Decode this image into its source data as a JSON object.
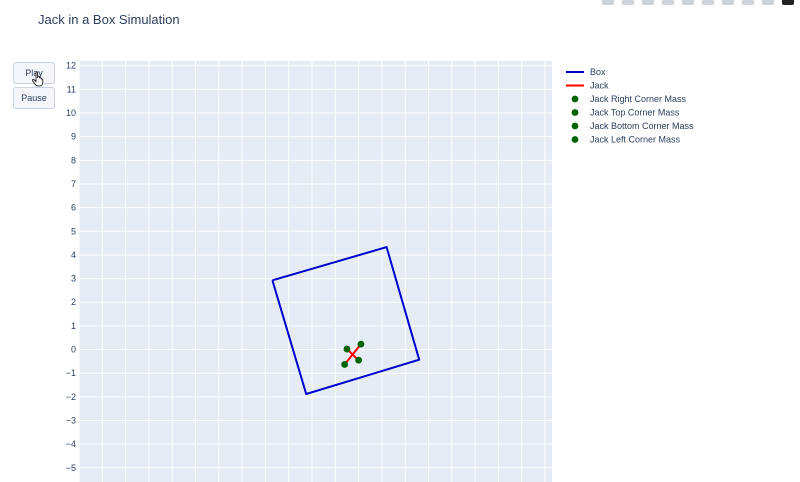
{
  "title": "Jack in a Box Simulation",
  "controls": {
    "play_label": "Play",
    "pause_label": "Pause"
  },
  "colors": {
    "plot_background": "#e5ecf6",
    "grid": "#ffffff",
    "box": "#0000cd",
    "jack": "#ff0000",
    "mass": "#006400",
    "text": "#2a3f5f"
  },
  "chart_data": {
    "type": "line",
    "title": "Jack in a Box Simulation",
    "xlabel": "",
    "ylabel": "",
    "xlim": [
      -12,
      8.3
    ],
    "ylim": [
      -5.6,
      12.2
    ],
    "y_ticks": [
      12,
      11,
      10,
      9,
      8,
      7,
      6,
      5,
      4,
      3,
      2,
      1,
      0,
      -1,
      -2,
      -3,
      -4,
      -5
    ],
    "y_tick_labels": [
      "12",
      "11",
      "10",
      "9",
      "8",
      "7",
      "6",
      "5",
      "4",
      "3",
      "2",
      "1",
      "0",
      "−1",
      "−2",
      "−3",
      "−4",
      "−5"
    ],
    "x_ticks_hidden": true,
    "grid": true,
    "legend": "right",
    "series": [
      {
        "name": "Box",
        "mode": "lines",
        "color": "#0000cd",
        "x": [
          -3.7,
          1.2,
          2.6,
          -2.25,
          -3.7
        ],
        "y": [
          2.93,
          4.33,
          -0.43,
          -1.88,
          2.93
        ]
      },
      {
        "name": "Jack",
        "mode": "lines",
        "color": "#ff0000",
        "x": [
          0.1,
          -0.6,
          null,
          -0.5,
          0.0
        ],
        "y": [
          0.23,
          -0.63,
          null,
          0.02,
          -0.45
        ]
      },
      {
        "name": "Jack Right Corner Mass",
        "mode": "markers",
        "color": "#006400",
        "x": [
          0.1
        ],
        "y": [
          0.23
        ]
      },
      {
        "name": "Jack Top Corner Mass",
        "mode": "markers",
        "color": "#006400",
        "x": [
          -0.6
        ],
        "y": [
          -0.63
        ]
      },
      {
        "name": "Jack Bottom Corner Mass",
        "mode": "markers",
        "color": "#006400",
        "x": [
          -0.5
        ],
        "y": [
          0.02
        ]
      },
      {
        "name": "Jack Left Corner Mass",
        "mode": "markers",
        "color": "#006400",
        "x": [
          0.0
        ],
        "y": [
          -0.45
        ]
      }
    ]
  }
}
